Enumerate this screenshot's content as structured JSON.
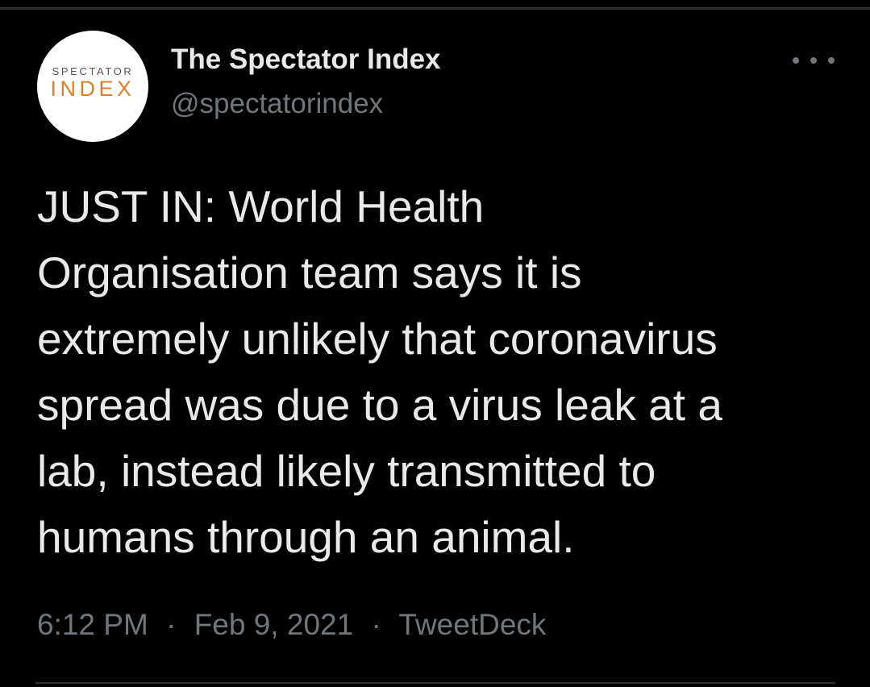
{
  "tweet": {
    "avatar": {
      "logo_top": "SPECTATOR",
      "logo_bottom": "INDEX"
    },
    "author": {
      "display_name": "The Spectator Index",
      "handle": "@spectatorindex"
    },
    "more_icon": "more-horizontal-icon",
    "text_lines": [
      "JUST IN: World Health",
      "Organisation team says it is",
      "extremely unlikely that coronavirus",
      "spread was due to a virus leak at a",
      "lab, instead likely transmitted to",
      "humans through an animal."
    ],
    "meta": {
      "time": "6:12 PM",
      "separator": "·",
      "date": "Feb 9, 2021",
      "source": "TweetDeck"
    }
  },
  "colors": {
    "background": "#000000",
    "primary_text": "#e7e9ea",
    "secondary_text": "#71767b",
    "divider": "#2f3336",
    "logo_orange": "#d9822b"
  }
}
